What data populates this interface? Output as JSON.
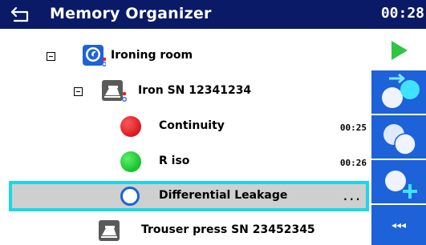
{
  "header": {
    "title": "Memory Organizer",
    "clock": "00:28"
  },
  "tree": {
    "location": {
      "label": "Ironing room",
      "icon": "location-icon"
    },
    "appliance": {
      "label": "Iron SN 12341234",
      "icon": "iron-icon"
    },
    "tests": [
      {
        "label": "Continuity",
        "time": "00:25",
        "status": "fail",
        "color": "#e8202a"
      },
      {
        "label": "R iso",
        "time": "00:26",
        "status": "pass",
        "color": "#22cc33"
      },
      {
        "label": "Differential Leakage",
        "time": "...",
        "status": "empty",
        "color": "#1565d8"
      }
    ],
    "next_appliance": {
      "label": "Trouser press SN 23452345",
      "icon": "iron-icon"
    }
  },
  "sidebar": {
    "more_label": "◂◂◂"
  },
  "colors": {
    "header_bg": "#0a1a66",
    "accent_blue": "#1d62d8",
    "selection_border": "#1ad8e8",
    "play_green": "#2fc642"
  }
}
